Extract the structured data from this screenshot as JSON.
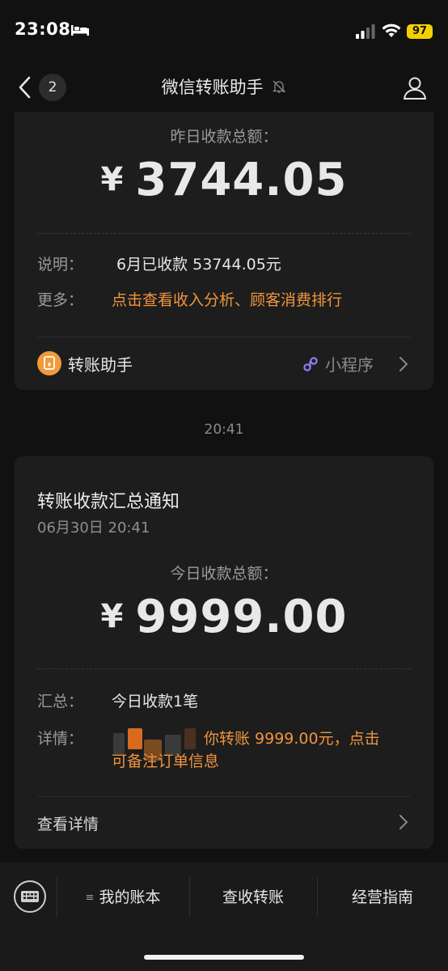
{
  "status_bar": {
    "time": "23:08",
    "battery": "97"
  },
  "nav": {
    "unread_count": "2",
    "title": "微信转账助手"
  },
  "card1": {
    "total_label": "昨日收款总额：",
    "currency": "¥",
    "amount": "3744.05",
    "note_label": "说明：",
    "note_value": "6月已收款 53744.05元",
    "more_label": "更多：",
    "more_value": "点击查看收入分析、顾客消费排行",
    "mini_name": "转账助手",
    "mini_tag": "小程序"
  },
  "timestamp": "20:41",
  "card2": {
    "title": "转账收款汇总通知",
    "date": "06月30日 20:41",
    "total_label": "今日收款总额：",
    "currency": "¥",
    "amount": "9999.00",
    "summary_label": "汇总：",
    "summary_value": "今日收款1笔",
    "detail_label": "详情：",
    "detail_line1": "你转账 9999.00元，点击",
    "detail_line2": "可备注订单信息",
    "view_details": "查看详情"
  },
  "bottom_tabs": [
    {
      "label": "我的账本"
    },
    {
      "label": "查收转账"
    },
    {
      "label": "经营指南"
    }
  ],
  "colors": {
    "accent_orange": "#f0943d",
    "background": "#111111",
    "card": "#1d1d1d"
  },
  "icons": [
    "bed-icon",
    "signal-icon",
    "wifi-icon",
    "back-icon",
    "mute-bell-icon",
    "profile-icon",
    "transfer-assistant-icon",
    "mini-program-link-icon",
    "chevron-right-icon",
    "keyboard-icon"
  ]
}
